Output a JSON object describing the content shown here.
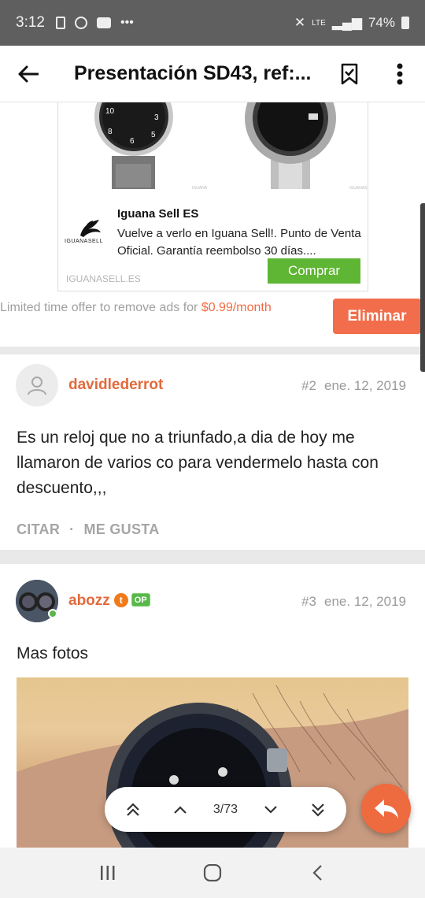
{
  "status_bar": {
    "time": "3:12",
    "network": "LTE",
    "battery": "74%"
  },
  "header": {
    "title": "Presentación SD43, ref:..."
  },
  "ad": {
    "advertiser": "Iguana Sell ES",
    "logo_text": "IGUANASELL",
    "description": "Vuelve a verlo en Iguana Sell!. Punto de Venta Oficial. Garantía reembolso 30 días....",
    "domain": "IGUANASELL.ES",
    "cta": "Comprar",
    "offer_text": "Limited time offer to remove ads for ",
    "offer_price": "$0.99/month",
    "remove_label": "Eliminar"
  },
  "posts": [
    {
      "username": "davidlederrot",
      "number": "#2",
      "date": "ene. 12, 2019",
      "text": "Es un reloj que no a triunfado,a dia de hoy me llamaron de varios co para vendermelo hasta con descuento,,,",
      "quote_label": "CITAR",
      "like_label": "ME GUSTA"
    },
    {
      "username": "abozz",
      "badge_t": "t",
      "badge_op": "OP",
      "number": "#3",
      "date": "ene. 12, 2019",
      "text": "Mas fotos"
    }
  ],
  "pager": {
    "position": "3/73"
  },
  "colors": {
    "accent": "#e36a3c",
    "cta_green": "#5fb534",
    "fab": "#ee6a3f"
  }
}
